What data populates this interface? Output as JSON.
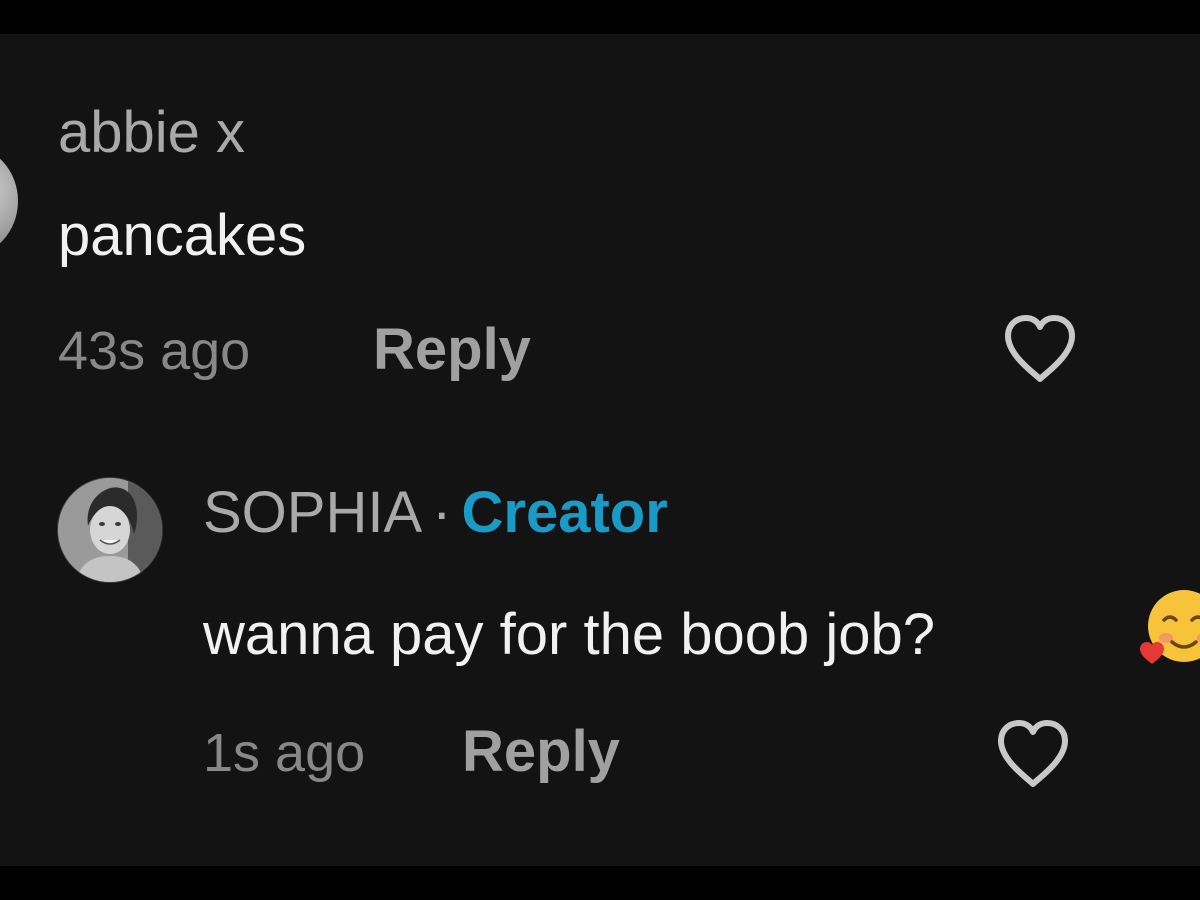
{
  "comments": [
    {
      "username": "abbie x",
      "text": "pancakes",
      "time": "43s ago",
      "reply_label": "Reply",
      "like_icon": "heart-outline-icon"
    },
    {
      "username": "SOPHIA",
      "separator": "·",
      "badge": "Creator",
      "text": "wanna pay for the boob job?",
      "emoji": "smiling-face-with-hearts-emoji",
      "time": "1s ago",
      "reply_label": "Reply",
      "like_icon": "heart-outline-icon"
    }
  ],
  "colors": {
    "background": "#131313",
    "username": "#a9a9a9",
    "comment_text": "#f1f1f1",
    "meta_text": "#888888",
    "creator_badge": "#1a9bc7"
  }
}
